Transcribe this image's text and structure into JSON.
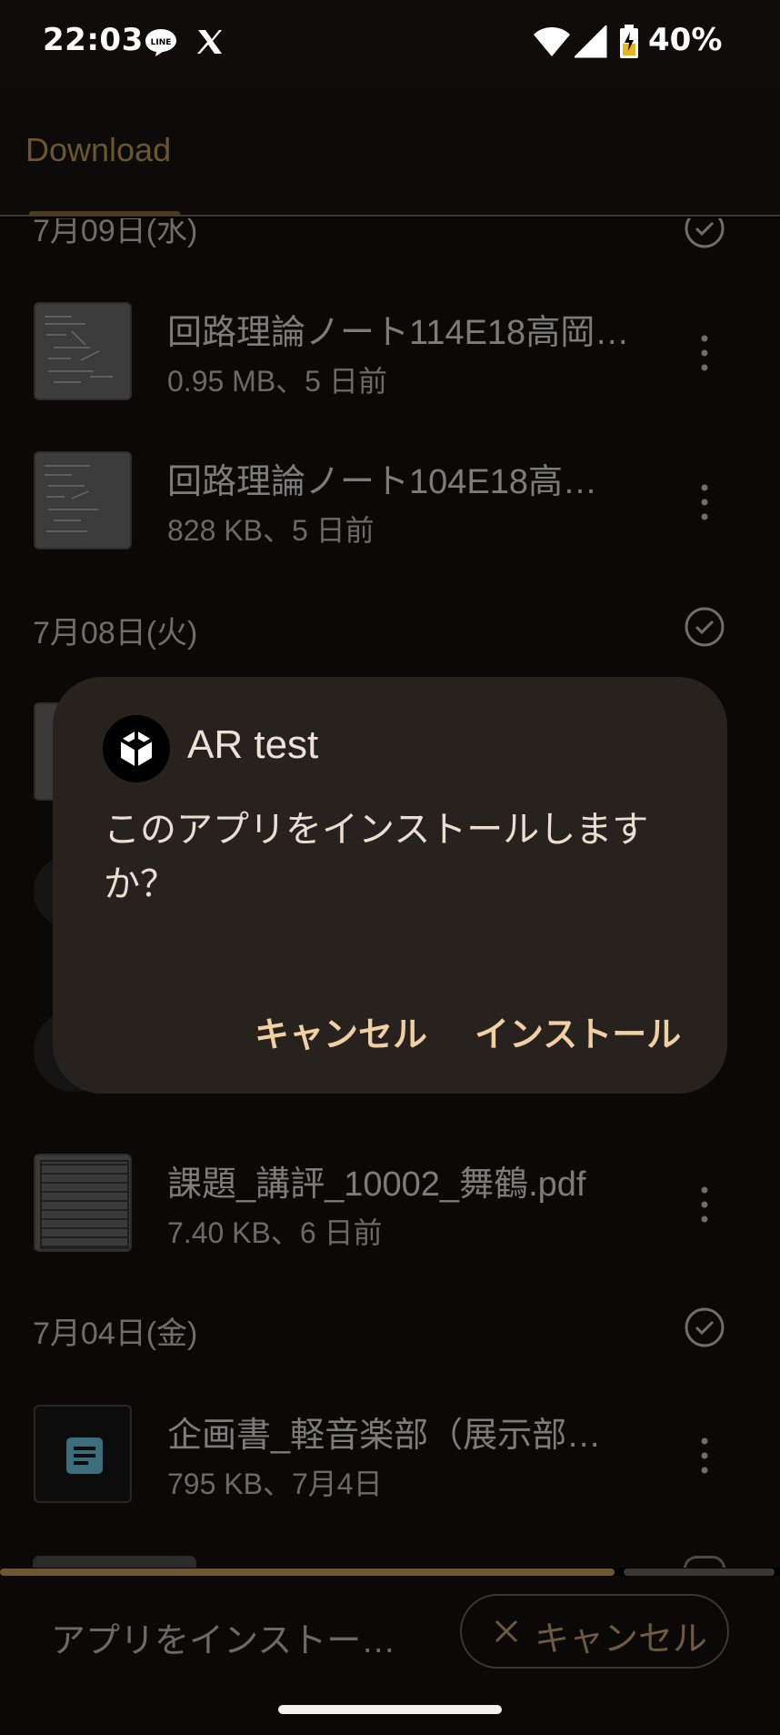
{
  "status_bar": {
    "time": "22:03",
    "battery": "40%",
    "icons": [
      "line-icon",
      "x-icon",
      "wifi-icon",
      "signal-icon",
      "battery-icon"
    ]
  },
  "app_bar": {
    "title": "Download"
  },
  "sections": [
    {
      "date": "7月09日(水)",
      "files": [
        {
          "name": "回路理論ノート114E18高岡…",
          "meta": "0.95 MB、5 日前",
          "thumb": "handwritten-note"
        },
        {
          "name": "回路理論ノート104E18高…",
          "meta": "828 KB、5 日前",
          "thumb": "handwritten-note"
        }
      ]
    },
    {
      "date": "7月08日(火)",
      "files": [
        {
          "name": "課題_講評_10002_舞鶴.pdf",
          "meta": "7.40 KB、6 日前",
          "thumb": "document-table"
        }
      ]
    },
    {
      "date": "7月04日(金)",
      "files": [
        {
          "name": "企画書_軽音楽部（展示部…",
          "meta": "795 KB、7月4日",
          "thumb": "doc-icon"
        }
      ]
    }
  ],
  "dialog": {
    "app_name": "AR test",
    "message": "このアプリをインストールしますか？",
    "cancel_label": "キャンセル",
    "install_label": "インストール"
  },
  "bottom_bar": {
    "status": "アプリをインストー…",
    "cancel_label": "キャンセル",
    "progress": 0.8
  },
  "colors": {
    "accent": "#f0cfa3",
    "dialog_bg": "#27221d",
    "progress": "#6e5632"
  }
}
